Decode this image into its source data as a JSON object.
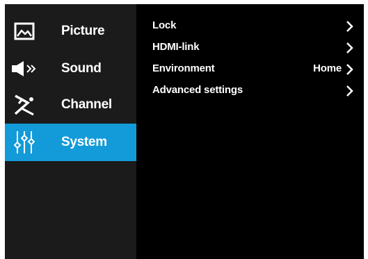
{
  "sidebar": {
    "items": [
      {
        "label": "Picture",
        "icon": "picture-icon"
      },
      {
        "label": "Sound",
        "icon": "sound-icon"
      },
      {
        "label": "Channel",
        "icon": "satellite-dish-icon"
      },
      {
        "label": "System",
        "icon": "sliders-icon",
        "active": true
      }
    ]
  },
  "menu": {
    "items": [
      {
        "label": "Lock",
        "value": ""
      },
      {
        "label": "HDMI-link",
        "value": ""
      },
      {
        "label": "Environment",
        "value": "Home"
      },
      {
        "label": "Advanced settings",
        "value": ""
      }
    ]
  },
  "colors": {
    "screen_bg": "#000000",
    "sidebar_bg": "#1b1b1b",
    "active_bg": "#129bd8",
    "text": "#ffffff"
  }
}
